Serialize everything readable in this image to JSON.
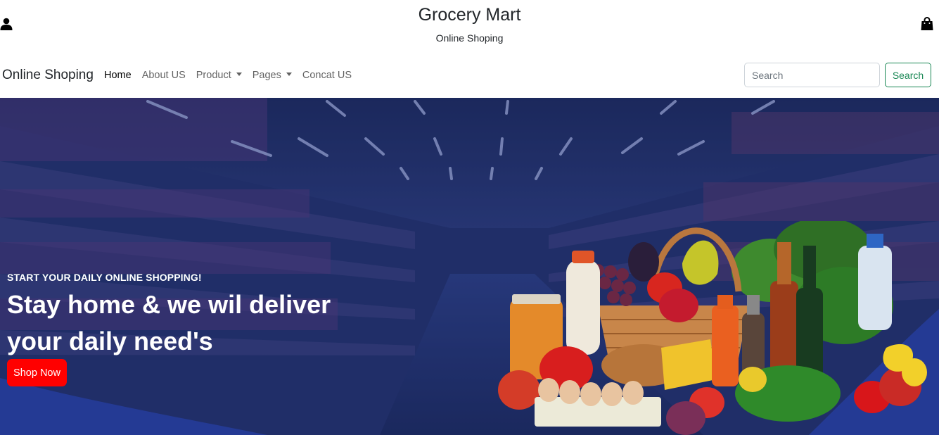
{
  "header": {
    "title": "Grocery Mart",
    "subtitle": "Online Shoping",
    "icons": {
      "user": "user-icon",
      "bag": "shopping-bag-icon"
    }
  },
  "navbar": {
    "brand": "Online Shoping",
    "links": [
      {
        "label": "Home",
        "active": true
      },
      {
        "label": "About US"
      },
      {
        "label": "Product",
        "dropdown": true
      },
      {
        "label": "Pages",
        "dropdown": true
      },
      {
        "label": "Concat US"
      }
    ],
    "search": {
      "placeholder": "Search",
      "value": "",
      "button_label": "Search"
    }
  },
  "hero": {
    "kicker": "START YOUR DAILY ONLINE SHOPPING!",
    "heading": "Stay home & we wil deliver your daily need's",
    "button_label": "Shop Now"
  },
  "colors": {
    "hero_overlay": "#1e2c62",
    "wave": "#243a94",
    "accent_button": "#ff0000",
    "search_outline": "#198754"
  }
}
